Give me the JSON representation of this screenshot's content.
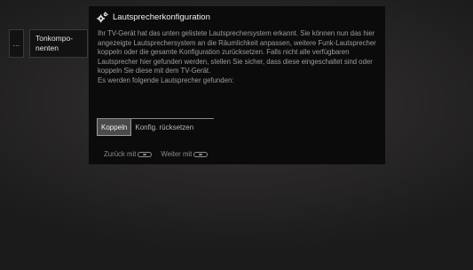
{
  "breadcrumb": {
    "more_label": "...",
    "current_label": "Tonkompo-\nnenten"
  },
  "dialog": {
    "title": "Lautsprecherkonfiguration",
    "title_icon": "gear-icon",
    "paragraph1": "Ihr TV-Gerät hat das unten gelistete Lautsprechersystem erkannt. Sie können nun das hier angezeigte Lautsprechersystem an die Räumlichkeit anpassen, weitere Funk-Lautsprecher koppeln oder die gesamte Konfiguration zurücksetzen. Falls nicht alle verfügbaren Lautsprecher hier gefunden werden, stellen Sie sicher, dass diese eingeschaltet sind oder koppeln Sie diese mit dem TV-Gerät.",
    "paragraph2": "Es werden folgende Lautsprecher gefunden:",
    "buttons": {
      "pair_label": "Koppeln",
      "reset_label": "Konfig. rücksetzen"
    },
    "footer": {
      "back_label": "Zurück mit",
      "next_label": "Weiter mit",
      "back_icon": "back-key-icon",
      "next_icon": "next-key-icon"
    }
  },
  "colors": {
    "dialog_background": "#0b0b0b",
    "body_text": "#9b9b9b",
    "selected_button": "#4a4a4a"
  }
}
